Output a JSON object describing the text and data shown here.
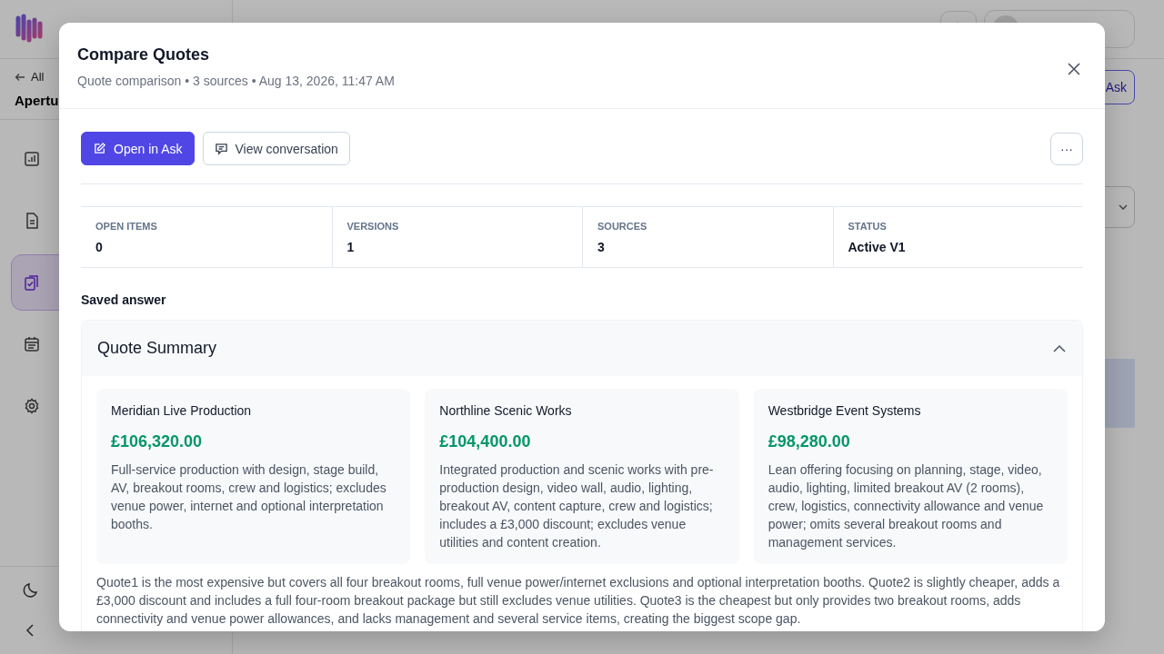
{
  "background": {
    "back_link": "All",
    "workspace": "Apertu",
    "nav": [
      {
        "kind": "chart",
        "selected": false
      },
      {
        "kind": "document",
        "selected": false
      },
      {
        "kind": "clipboard",
        "selected": true
      },
      {
        "kind": "calendar",
        "selected": false
      },
      {
        "kind": "gear",
        "selected": false
      }
    ],
    "footer": [
      {
        "kind": "moon"
      },
      {
        "kind": "chevron"
      }
    ],
    "ask_button": "Ask"
  },
  "modal": {
    "title": "Compare Quotes",
    "subtitle": "Quote comparison • 3 sources • Aug 13, 2026, 11:47 AM",
    "actions": [
      {
        "kind": "primary",
        "label": "Open in Ask"
      },
      {
        "kind": "secondary",
        "label": "View conversation"
      }
    ],
    "more": "···",
    "stats": [
      {
        "label": "OPEN ITEMS",
        "value": "0"
      },
      {
        "label": "VERSIONS",
        "value": "1"
      },
      {
        "label": "SOURCES",
        "value": "3"
      },
      {
        "label": "STATUS",
        "value": "Active V1"
      }
    ],
    "section_title": "Saved answer",
    "accordion": {
      "title": "Quote Summary",
      "expanded": true,
      "quotes": [
        {
          "name": "Meridian Live Production",
          "price": "£106,320.00",
          "description": "Full-service production with design, stage build, AV, breakout rooms, crew and logistics; excludes venue power, internet and optional interpretation booths."
        },
        {
          "name": "Northline Scenic Works",
          "price": "£104,400.00",
          "description": "Integrated production and scenic works with pre-production design, video wall, audio, lighting, breakout AV, content capture, crew and logistics; includes a £3,000 discount; excludes venue utilities and content creation."
        },
        {
          "name": "Westbridge Event Systems",
          "price": "£98,280.00",
          "description": "Lean offering focusing on planning, stage, video, audio, lighting, limited breakout AV (2 rooms), crew, logistics, connectivity allowance and venue power; omits several breakout rooms and management services."
        }
      ],
      "summary": "Quote1 is the most expensive but covers all four breakout rooms, full venue power/internet exclusions and optional interpretation booths. Quote2 is slightly cheaper, adds a £3,000 discount and includes a full four-room breakout package but still excludes venue utilities. Quote3 is the cheapest but only provides two breakout rooms, adds connectivity and venue power allowances, and lacks management and several service items, creating the biggest scope gap."
    }
  }
}
